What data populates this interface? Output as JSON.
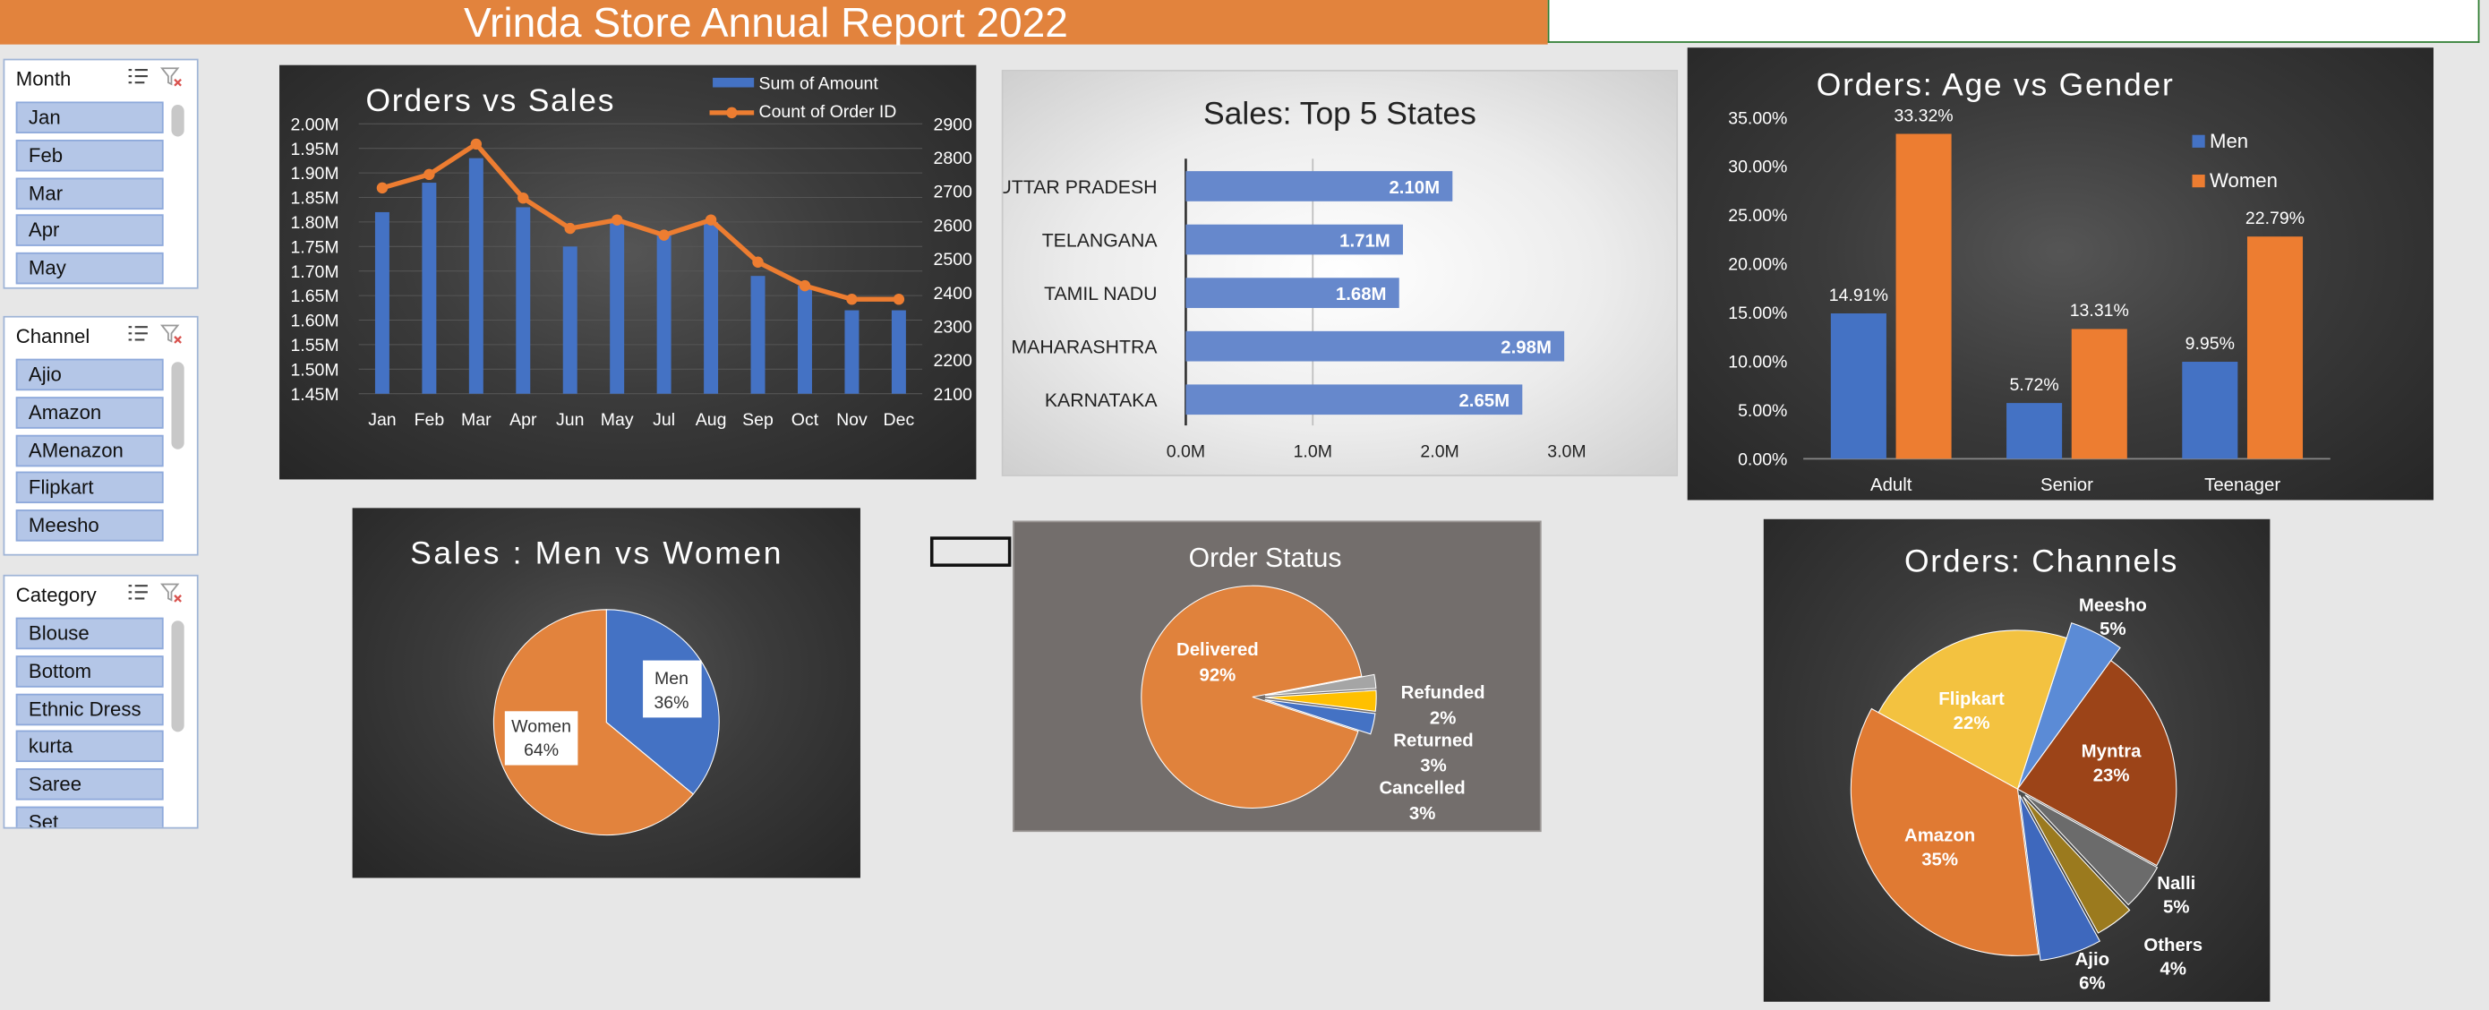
{
  "header": {
    "title": "Vrinda Store Annual Report 2022"
  },
  "slicers": {
    "month": {
      "title": "Month",
      "items": [
        "Jan",
        "Feb",
        "Mar",
        "Apr",
        "May"
      ]
    },
    "channel": {
      "title": "Channel",
      "items": [
        "Ajio",
        "Amazon",
        "AMenazon",
        "Flipkart",
        "Meesho"
      ]
    },
    "category": {
      "title": "Category",
      "items": [
        "Blouse",
        "Bottom",
        "Ethnic Dress",
        "kurta",
        "Saree",
        "Set"
      ]
    }
  },
  "colors": {
    "blue": "#4472c4",
    "orange": "#ed7d31",
    "yellow": "#ffc000",
    "gray": "#a5a5a5",
    "title_orange": "#e2833d"
  },
  "chart_data": [
    {
      "type": "bar",
      "title": "Orders vs Sales",
      "categories": [
        "Jan",
        "Feb",
        "Mar",
        "Apr",
        "Jun",
        "May",
        "Jul",
        "Aug",
        "Sep",
        "Oct",
        "Nov",
        "Dec"
      ],
      "series": [
        {
          "name": "Sum of Amount",
          "type": "bar",
          "axis": "left",
          "values": [
            1.82,
            1.88,
            1.93,
            1.83,
            1.75,
            1.8,
            1.78,
            1.8,
            1.69,
            1.67,
            1.62,
            1.62
          ]
        },
        {
          "name": "Count of Order ID",
          "type": "line",
          "axis": "right",
          "values": [
            2710,
            2750,
            2840,
            2680,
            2590,
            2615,
            2570,
            2615,
            2490,
            2420,
            2380,
            2380
          ]
        }
      ],
      "y_left": {
        "ticks": [
          "1.45M",
          "1.50M",
          "1.55M",
          "1.60M",
          "1.65M",
          "1.70M",
          "1.75M",
          "1.80M",
          "1.85M",
          "1.90M",
          "1.95M",
          "2.00M"
        ],
        "min": 1.45,
        "max": 2.0
      },
      "y_right": {
        "ticks": [
          "2100",
          "2200",
          "2300",
          "2400",
          "2500",
          "2600",
          "2700",
          "2800",
          "2900"
        ],
        "min": 2100,
        "max": 2900
      },
      "legend": "top-right"
    },
    {
      "type": "bar",
      "orientation": "horizontal",
      "title": "Sales: Top 5 States",
      "categories": [
        "UTTAR PRADESH",
        "TELANGANA",
        "TAMIL NADU",
        "MAHARASHTRA",
        "KARNATAKA"
      ],
      "values": [
        2.1,
        1.71,
        1.68,
        2.98,
        2.65
      ],
      "labels": [
        "2.10M",
        "1.71M",
        "1.68M",
        "2.98M",
        "2.65M"
      ],
      "x_ticks": [
        "0.0M",
        "1.0M",
        "2.0M",
        "3.0M"
      ],
      "xlim": [
        0,
        3.4
      ]
    },
    {
      "type": "bar",
      "title": "Orders: Age vs Gender",
      "categories": [
        "Adult",
        "Senior",
        "Teenager"
      ],
      "series": [
        {
          "name": "Men",
          "values": [
            14.91,
            5.72,
            9.95
          ],
          "labels": [
            "14.91%",
            "5.72%",
            "9.95%"
          ]
        },
        {
          "name": "Women",
          "values": [
            33.32,
            13.31,
            22.79
          ],
          "labels": [
            "33.32%",
            "13.31%",
            "22.79%"
          ]
        }
      ],
      "y_ticks": [
        "0.00%",
        "5.00%",
        "10.00%",
        "15.00%",
        "20.00%",
        "25.00%",
        "30.00%",
        "35.00%"
      ],
      "ylim": [
        0,
        35
      ],
      "legend": "top-right"
    },
    {
      "type": "pie",
      "title": "Sales : Men vs Women",
      "slices": [
        {
          "name": "Men",
          "value": 36,
          "label": "36%"
        },
        {
          "name": "Women",
          "value": 64,
          "label": "64%"
        }
      ]
    },
    {
      "type": "pie",
      "title": "Order Status",
      "slices": [
        {
          "name": "Delivered",
          "value": 92,
          "label": "92%"
        },
        {
          "name": "Refunded",
          "value": 2,
          "label": "2%"
        },
        {
          "name": "Returned",
          "value": 3,
          "label": "3%"
        },
        {
          "name": "Cancelled",
          "value": 3,
          "label": "3%"
        }
      ]
    },
    {
      "type": "pie",
      "title": "Orders: Channels",
      "slices": [
        {
          "name": "Meesho",
          "value": 5,
          "label": "5%"
        },
        {
          "name": "Myntra",
          "value": 23,
          "label": "23%"
        },
        {
          "name": "Nalli",
          "value": 5,
          "label": "5%"
        },
        {
          "name": "Others",
          "value": 4,
          "label": "4%"
        },
        {
          "name": "Ajio",
          "value": 6,
          "label": "6%"
        },
        {
          "name": "Amazon",
          "value": 35,
          "label": "35%"
        },
        {
          "name": "Flipkart",
          "value": 22,
          "label": "22%"
        }
      ]
    }
  ]
}
